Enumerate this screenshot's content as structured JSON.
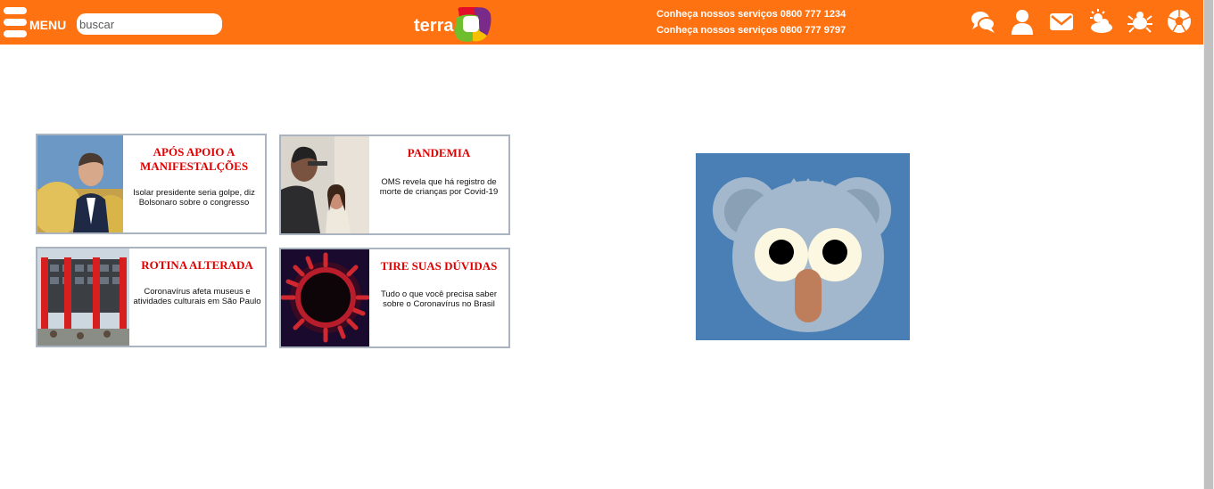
{
  "header": {
    "menu_label": "MENU",
    "search_placeholder": "buscar",
    "logo_text": "terra",
    "contact_lines": [
      "Conheça nossos serviços 0800 777 1234",
      "Conheça nossos serviços 0800 777 9797"
    ],
    "icons": [
      "chat-icon",
      "user-icon",
      "mail-icon",
      "weather-icon",
      "horoscope-icon",
      "soccer-ball-icon"
    ]
  },
  "cards": [
    {
      "title": "APÓS APOIO A MANIFESTALÇÕES",
      "subtitle": "Isolar presidente seria golpe, diz Bolsonaro sobre o congresso"
    },
    {
      "title": "PANDEMIA",
      "subtitle": "OMS revela que há registro de morte de crianças por Covid-19"
    },
    {
      "title": "ROTINA ALTERADA",
      "subtitle": "Coronavírus afeta museus e atividades culturais em São Paulo"
    },
    {
      "title": "TIRE SUAS DÚVIDAS",
      "subtitle": "Tudo o que você precisa saber sobre o Coronavírus no Brasil"
    }
  ],
  "colors": {
    "header_bg": "#ff7212",
    "card_title": "#e00000",
    "card_border": "#a9b4c0",
    "ad_bg": "#4a7fb5"
  }
}
